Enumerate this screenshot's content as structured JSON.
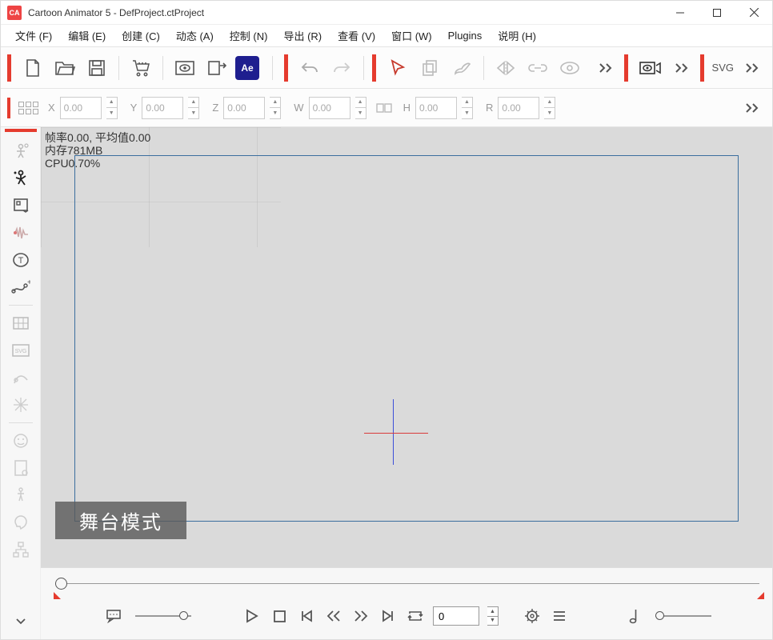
{
  "window": {
    "title": "Cartoon Animator 5 - DefProject.ctProject",
    "app_badge": "CA"
  },
  "menu": {
    "file": "文件 (F)",
    "edit": "编辑 (E)",
    "create": "创建 (C)",
    "dynamic": "动态 (A)",
    "control": "控制 (N)",
    "export": "导出 (R)",
    "view": "查看 (V)",
    "window": "窗口 (W)",
    "plugins": "Plugins",
    "help": "说明 (H)"
  },
  "toolbar": {
    "ae_label": "Ae",
    "svg_label": "SVG"
  },
  "coords": {
    "x_label": "X",
    "x_val": "0.00",
    "y_label": "Y",
    "y_val": "0.00",
    "z_label": "Z",
    "z_val": "0.00",
    "w_label": "W",
    "w_val": "0.00",
    "h_label": "H",
    "h_val": "0.00",
    "r_label": "R",
    "r_val": "0.00"
  },
  "canvas": {
    "stats_fps": "帧率0.00, 平均值0.00",
    "stats_mem": "内存781MB",
    "stats_cpu": "CPU0.70%",
    "mode_label": "舞台模式"
  },
  "timeline": {
    "frame_value": "0"
  }
}
